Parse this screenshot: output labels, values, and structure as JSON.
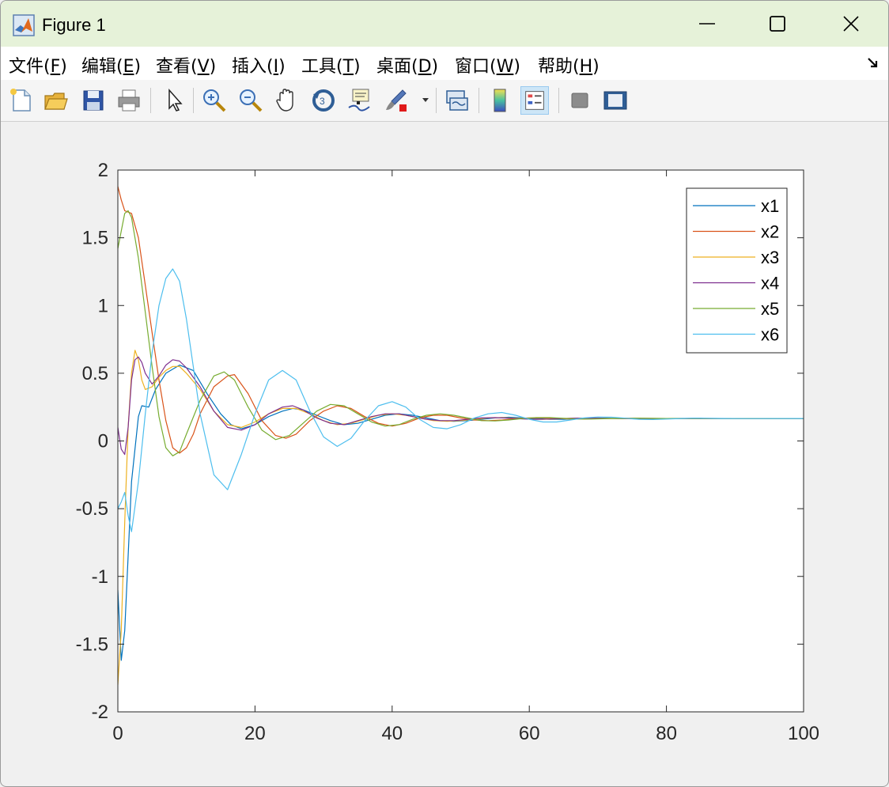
{
  "window": {
    "title": "Figure 1"
  },
  "menu": [
    {
      "pre": "文件(",
      "key": "F",
      "post": ")"
    },
    {
      "pre": "编辑(",
      "key": "E",
      "post": ")"
    },
    {
      "pre": "查看(",
      "key": "V",
      "post": ")"
    },
    {
      "pre": "插入(",
      "key": "I",
      "post": ")"
    },
    {
      "pre": "工具(",
      "key": "T",
      "post": ")"
    },
    {
      "pre": "桌面(",
      "key": "D",
      "post": ")"
    },
    {
      "pre": "窗口(",
      "key": "W",
      "post": ")"
    },
    {
      "pre": "帮助(",
      "key": "H",
      "post": ")"
    }
  ],
  "toolbar": {
    "icons": [
      "new-figure-icon",
      "open-file-icon",
      "save-icon",
      "print-icon",
      "pointer-icon",
      "zoom-in-icon",
      "zoom-out-icon",
      "pan-hand-icon",
      "rotate-3d-icon",
      "data-cursor-icon",
      "brush-icon",
      "link-plot-icon",
      "colorbar-icon",
      "legend-icon",
      "hide-plot-tools-icon",
      "show-plot-tools-icon"
    ],
    "active": "legend-icon"
  },
  "chart_data": {
    "type": "line",
    "title": "",
    "xlabel": "",
    "ylabel": "",
    "xlim": [
      0,
      100
    ],
    "ylim": [
      -2,
      2
    ],
    "xticks": [
      0,
      20,
      40,
      60,
      80,
      100
    ],
    "yticks": [
      -2,
      -1.5,
      -1,
      -0.5,
      0,
      0.5,
      1,
      1.5,
      2
    ],
    "legend_position": "top-right",
    "grid": false,
    "series": [
      {
        "name": "x1",
        "color": "#0072BD",
        "points": [
          [
            0,
            -1.1
          ],
          [
            0.5,
            -1.62
          ],
          [
            1,
            -1.4
          ],
          [
            2,
            -0.3
          ],
          [
            3,
            0.18
          ],
          [
            3.5,
            0.26
          ],
          [
            4.5,
            0.25
          ],
          [
            5.5,
            0.38
          ],
          [
            7,
            0.5
          ],
          [
            9,
            0.56
          ],
          [
            11,
            0.52
          ],
          [
            13,
            0.35
          ],
          [
            15,
            0.2
          ],
          [
            16.5,
            0.12
          ],
          [
            18,
            0.09
          ],
          [
            20,
            0.12
          ],
          [
            22,
            0.18
          ],
          [
            24,
            0.22
          ],
          [
            25.5,
            0.24
          ],
          [
            27,
            0.23
          ],
          [
            29,
            0.19
          ],
          [
            31,
            0.15
          ],
          [
            33,
            0.12
          ],
          [
            35,
            0.13
          ],
          [
            37,
            0.16
          ],
          [
            39,
            0.19
          ],
          [
            41,
            0.2
          ],
          [
            43,
            0.19
          ],
          [
            45,
            0.17
          ],
          [
            47,
            0.15
          ],
          [
            49,
            0.145
          ],
          [
            51,
            0.15
          ],
          [
            53,
            0.16
          ],
          [
            55,
            0.17
          ],
          [
            57,
            0.175
          ],
          [
            59,
            0.17
          ],
          [
            61,
            0.165
          ],
          [
            63,
            0.16
          ],
          [
            65,
            0.16
          ],
          [
            67,
            0.165
          ],
          [
            69,
            0.17
          ],
          [
            71,
            0.168
          ],
          [
            73,
            0.165
          ],
          [
            76,
            0.163
          ],
          [
            80,
            0.166
          ],
          [
            85,
            0.167
          ],
          [
            90,
            0.166
          ],
          [
            100,
            0.166
          ]
        ]
      },
      {
        "name": "x2",
        "color": "#D95319",
        "points": [
          [
            0,
            1.88
          ],
          [
            0.5,
            1.78
          ],
          [
            1,
            1.7
          ],
          [
            2,
            1.68
          ],
          [
            3,
            1.5
          ],
          [
            4,
            1.15
          ],
          [
            5,
            0.8
          ],
          [
            6,
            0.45
          ],
          [
            7,
            0.15
          ],
          [
            8,
            -0.05
          ],
          [
            9,
            -0.09
          ],
          [
            10,
            -0.05
          ],
          [
            11,
            0.05
          ],
          [
            12,
            0.2
          ],
          [
            14,
            0.4
          ],
          [
            16,
            0.48
          ],
          [
            17,
            0.49
          ],
          [
            19,
            0.35
          ],
          [
            21,
            0.15
          ],
          [
            23,
            0.04
          ],
          [
            24.5,
            0.02
          ],
          [
            26,
            0.05
          ],
          [
            28,
            0.15
          ],
          [
            30,
            0.22
          ],
          [
            32,
            0.26
          ],
          [
            34,
            0.24
          ],
          [
            36,
            0.18
          ],
          [
            38,
            0.13
          ],
          [
            40,
            0.11
          ],
          [
            42,
            0.13
          ],
          [
            44,
            0.17
          ],
          [
            46,
            0.19
          ],
          [
            48,
            0.19
          ],
          [
            50,
            0.17
          ],
          [
            52,
            0.155
          ],
          [
            54,
            0.15
          ],
          [
            56,
            0.155
          ],
          [
            58,
            0.165
          ],
          [
            60,
            0.17
          ],
          [
            62,
            0.17
          ],
          [
            64,
            0.165
          ],
          [
            66,
            0.163
          ],
          [
            68,
            0.163
          ],
          [
            70,
            0.166
          ],
          [
            75,
            0.167
          ],
          [
            80,
            0.166
          ],
          [
            90,
            0.166
          ],
          [
            100,
            0.166
          ]
        ]
      },
      {
        "name": "x3",
        "color": "#EDB120",
        "points": [
          [
            0,
            -1.8
          ],
          [
            0.5,
            -1.4
          ],
          [
            1,
            -0.6
          ],
          [
            1.5,
            0.1
          ],
          [
            2,
            0.5
          ],
          [
            2.5,
            0.67
          ],
          [
            3,
            0.6
          ],
          [
            3.5,
            0.45
          ],
          [
            4,
            0.38
          ],
          [
            5,
            0.4
          ],
          [
            6,
            0.47
          ],
          [
            7,
            0.52
          ],
          [
            8,
            0.55
          ],
          [
            9,
            0.55
          ],
          [
            10,
            0.5
          ],
          [
            12,
            0.38
          ],
          [
            14,
            0.22
          ],
          [
            16,
            0.12
          ],
          [
            18,
            0.1
          ],
          [
            20,
            0.14
          ],
          [
            22,
            0.2
          ],
          [
            24,
            0.24
          ],
          [
            26,
            0.24
          ],
          [
            28,
            0.2
          ],
          [
            30,
            0.15
          ],
          [
            32,
            0.12
          ],
          [
            34,
            0.13
          ],
          [
            36,
            0.16
          ],
          [
            38,
            0.19
          ],
          [
            40,
            0.2
          ],
          [
            42,
            0.19
          ],
          [
            44,
            0.17
          ],
          [
            46,
            0.15
          ],
          [
            48,
            0.145
          ],
          [
            50,
            0.15
          ],
          [
            52,
            0.16
          ],
          [
            54,
            0.17
          ],
          [
            56,
            0.172
          ],
          [
            58,
            0.168
          ],
          [
            60,
            0.162
          ],
          [
            62,
            0.16
          ],
          [
            64,
            0.163
          ],
          [
            66,
            0.167
          ],
          [
            68,
            0.169
          ],
          [
            70,
            0.167
          ],
          [
            75,
            0.164
          ],
          [
            80,
            0.166
          ],
          [
            90,
            0.166
          ],
          [
            100,
            0.166
          ]
        ]
      },
      {
        "name": "x4",
        "color": "#7E2F8E",
        "points": [
          [
            0,
            0.1
          ],
          [
            0.5,
            -0.06
          ],
          [
            1,
            -0.1
          ],
          [
            1.5,
            0.1
          ],
          [
            2,
            0.45
          ],
          [
            2.5,
            0.6
          ],
          [
            3,
            0.62
          ],
          [
            3.5,
            0.58
          ],
          [
            4,
            0.5
          ],
          [
            5,
            0.42
          ],
          [
            6,
            0.48
          ],
          [
            7,
            0.56
          ],
          [
            8,
            0.6
          ],
          [
            9,
            0.59
          ],
          [
            10,
            0.54
          ],
          [
            12,
            0.4
          ],
          [
            14,
            0.22
          ],
          [
            16,
            0.1
          ],
          [
            18,
            0.08
          ],
          [
            20,
            0.12
          ],
          [
            22,
            0.2
          ],
          [
            24,
            0.25
          ],
          [
            25.5,
            0.26
          ],
          [
            27,
            0.23
          ],
          [
            29,
            0.17
          ],
          [
            31,
            0.13
          ],
          [
            33,
            0.12
          ],
          [
            35,
            0.15
          ],
          [
            37,
            0.18
          ],
          [
            39,
            0.2
          ],
          [
            41,
            0.2
          ],
          [
            43,
            0.18
          ],
          [
            45,
            0.16
          ],
          [
            47,
            0.15
          ],
          [
            49,
            0.15
          ],
          [
            51,
            0.16
          ],
          [
            53,
            0.17
          ],
          [
            55,
            0.172
          ],
          [
            57,
            0.168
          ],
          [
            59,
            0.163
          ],
          [
            61,
            0.16
          ],
          [
            63,
            0.162
          ],
          [
            65,
            0.166
          ],
          [
            67,
            0.168
          ],
          [
            70,
            0.167
          ],
          [
            75,
            0.165
          ],
          [
            80,
            0.166
          ],
          [
            90,
            0.166
          ],
          [
            100,
            0.166
          ]
        ]
      },
      {
        "name": "x5",
        "color": "#77AC30",
        "points": [
          [
            0,
            1.42
          ],
          [
            0.5,
            1.55
          ],
          [
            1,
            1.68
          ],
          [
            1.5,
            1.7
          ],
          [
            2,
            1.65
          ],
          [
            3,
            1.35
          ],
          [
            4,
            0.95
          ],
          [
            5,
            0.55
          ],
          [
            6,
            0.18
          ],
          [
            7,
            -0.05
          ],
          [
            8,
            -0.11
          ],
          [
            9,
            -0.08
          ],
          [
            10,
            0.05
          ],
          [
            12,
            0.3
          ],
          [
            14,
            0.48
          ],
          [
            15.5,
            0.51
          ],
          [
            17,
            0.45
          ],
          [
            19,
            0.25
          ],
          [
            21,
            0.08
          ],
          [
            23,
            0.01
          ],
          [
            25,
            0.04
          ],
          [
            27,
            0.13
          ],
          [
            29,
            0.22
          ],
          [
            31,
            0.27
          ],
          [
            33,
            0.26
          ],
          [
            35,
            0.2
          ],
          [
            37,
            0.14
          ],
          [
            39,
            0.11
          ],
          [
            41,
            0.12
          ],
          [
            43,
            0.16
          ],
          [
            45,
            0.19
          ],
          [
            47,
            0.2
          ],
          [
            49,
            0.19
          ],
          [
            51,
            0.17
          ],
          [
            53,
            0.15
          ],
          [
            55,
            0.148
          ],
          [
            57,
            0.155
          ],
          [
            59,
            0.165
          ],
          [
            61,
            0.172
          ],
          [
            63,
            0.172
          ],
          [
            65,
            0.167
          ],
          [
            67,
            0.162
          ],
          [
            69,
            0.162
          ],
          [
            72,
            0.166
          ],
          [
            76,
            0.168
          ],
          [
            80,
            0.166
          ],
          [
            90,
            0.166
          ],
          [
            100,
            0.166
          ]
        ]
      },
      {
        "name": "x6",
        "color": "#4DBEEE",
        "points": [
          [
            0,
            -0.5
          ],
          [
            0.5,
            -0.45
          ],
          [
            1,
            -0.38
          ],
          [
            1.5,
            -0.55
          ],
          [
            2,
            -0.67
          ],
          [
            3,
            -0.3
          ],
          [
            4,
            0.2
          ],
          [
            5,
            0.65
          ],
          [
            6,
            1.0
          ],
          [
            7,
            1.2
          ],
          [
            8,
            1.27
          ],
          [
            9,
            1.18
          ],
          [
            10,
            0.9
          ],
          [
            12,
            0.2
          ],
          [
            14,
            -0.25
          ],
          [
            16,
            -0.36
          ],
          [
            18,
            -0.1
          ],
          [
            20,
            0.2
          ],
          [
            22,
            0.45
          ],
          [
            24,
            0.52
          ],
          [
            26,
            0.45
          ],
          [
            28,
            0.22
          ],
          [
            30,
            0.03
          ],
          [
            32,
            -0.04
          ],
          [
            34,
            0.02
          ],
          [
            36,
            0.15
          ],
          [
            38,
            0.26
          ],
          [
            40,
            0.29
          ],
          [
            42,
            0.25
          ],
          [
            44,
            0.16
          ],
          [
            46,
            0.1
          ],
          [
            48,
            0.09
          ],
          [
            50,
            0.12
          ],
          [
            52,
            0.17
          ],
          [
            54,
            0.2
          ],
          [
            56,
            0.21
          ],
          [
            58,
            0.19
          ],
          [
            60,
            0.16
          ],
          [
            62,
            0.14
          ],
          [
            64,
            0.14
          ],
          [
            66,
            0.155
          ],
          [
            68,
            0.17
          ],
          [
            70,
            0.177
          ],
          [
            72,
            0.175
          ],
          [
            74,
            0.168
          ],
          [
            76,
            0.16
          ],
          [
            78,
            0.158
          ],
          [
            80,
            0.162
          ],
          [
            84,
            0.168
          ],
          [
            88,
            0.166
          ],
          [
            92,
            0.165
          ],
          [
            100,
            0.166
          ]
        ]
      }
    ]
  }
}
